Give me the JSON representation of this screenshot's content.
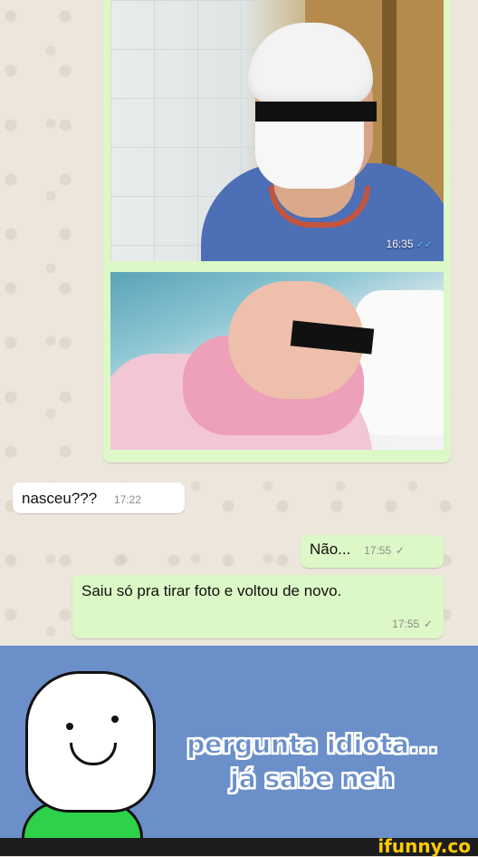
{
  "photo_message": {
    "time": "16:35",
    "status": "read",
    "tick_color": "#4fc3f7"
  },
  "messages": [
    {
      "direction": "incoming",
      "text": "nasceu???",
      "time": "17:22"
    },
    {
      "direction": "outgoing",
      "text": "Não...",
      "time": "17:55",
      "status_icon": "✓"
    },
    {
      "direction": "outgoing",
      "text": "Saiu só pra tirar foto e voltou  de novo.",
      "time": "17:55",
      "status_icon": "✓"
    }
  ],
  "meme": {
    "line1": "pergunta idiota...",
    "line2": "já sabe neh",
    "background": "#6b8fc9",
    "shirt_color": "#2ed14a"
  },
  "watermark": {
    "text": "ifunny.co",
    "color": "#ffcc00"
  },
  "colors": {
    "incoming_bubble": "#ffffff",
    "outgoing_bubble": "#dcf8c6",
    "chat_bg": "#ece6dc"
  }
}
